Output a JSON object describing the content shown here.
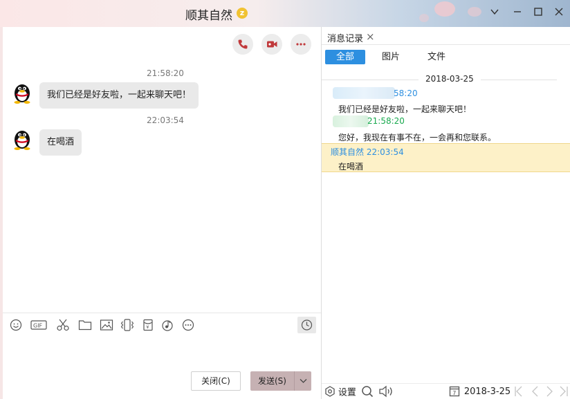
{
  "window": {
    "title": "顺其自然",
    "title_badge": "z",
    "controls": [
      "chevron-down-icon",
      "minimize-icon",
      "maximize-icon",
      "close-icon"
    ]
  },
  "chat": {
    "actions": [
      "phone-icon",
      "video-icon",
      "more-icon"
    ],
    "messages": [
      {
        "time": "21:58:20",
        "text": "我们已经是好友啦，一起来聊天吧！"
      },
      {
        "time": "22:03:54",
        "text": "在喝酒"
      }
    ],
    "toolbar": [
      "emoji-icon",
      "gif-icon",
      "scissors-icon",
      "folder-icon",
      "image-icon",
      "shake-icon",
      "red-packet-icon",
      "music-icon",
      "more-icon",
      "history-clock-icon"
    ],
    "close_label": "关闭(C)",
    "send_label": "发送(S)"
  },
  "history": {
    "tab_label": "消息记录",
    "filters": [
      "全部",
      "图片",
      "文件"
    ],
    "active_filter": "全部",
    "date": "2018-03-25",
    "entries": [
      {
        "sender_time": "58:20",
        "text": "我们已经是好友啦，一起来聊天吧！",
        "color": "#2d8fe0"
      },
      {
        "sender_time": "21:58:20",
        "text": "您好，我现在有事不在，一会再和您联系。",
        "color": "#18a94e"
      },
      {
        "sender_time": "顺其自然 22:03:54",
        "text": "在喝酒",
        "color": "#2d8fe0"
      }
    ],
    "settings_label": "设置",
    "footer_date": "2018-3-25",
    "calendar_day": "7"
  },
  "colors": {
    "accent": "#2d8fe0",
    "send_button": "#c6b1b3",
    "highlight_row": "#fdf1c8"
  }
}
